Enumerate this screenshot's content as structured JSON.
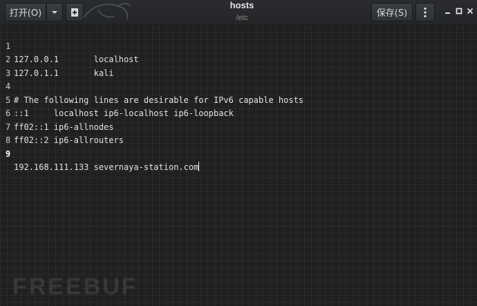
{
  "window": {
    "title": "hosts",
    "subtitle": "/etc"
  },
  "toolbar": {
    "open_label": "打开(O)",
    "save_label": "保存(S)"
  },
  "editor": {
    "lines": [
      {
        "num": "1",
        "text": "127.0.0.1       localhost"
      },
      {
        "num": "2",
        "text": "127.0.1.1       kali"
      },
      {
        "num": "3",
        "text": ""
      },
      {
        "num": "4",
        "text": "# The following lines are desirable for IPv6 capable hosts"
      },
      {
        "num": "5",
        "text": "::1     localhost ip6-localhost ip6-loopback"
      },
      {
        "num": "6",
        "text": "ff02::1 ip6-allnodes"
      },
      {
        "num": "7",
        "text": "ff02::2 ip6-allrouters"
      },
      {
        "num": "8",
        "text": ""
      },
      {
        "num": "9",
        "text": "192.168.111.133 severnaya-station.com"
      }
    ],
    "current_line": 9
  },
  "watermark": "FREEBUF",
  "colors": {
    "background": "#1e2022",
    "headerbar": "#2a2c2f",
    "text": "#e2e2e2"
  }
}
